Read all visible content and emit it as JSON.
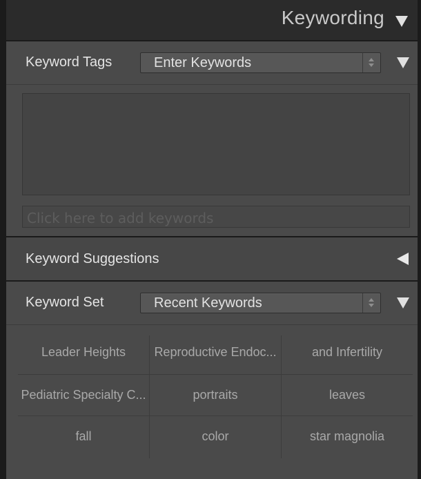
{
  "header": {
    "title": "Keywording"
  },
  "keyword_tags": {
    "label": "Keyword Tags",
    "mode_value": "Enter Keywords",
    "placeholder": "Click here to add keywords"
  },
  "keyword_suggestions": {
    "label": "Keyword Suggestions"
  },
  "keyword_set": {
    "label": "Keyword Set",
    "set_value": "Recent Keywords",
    "keywords": [
      "Leader Heights",
      "Reproductive Endoc...",
      "and Infertility",
      "Pediatric Specialty C...",
      "portraits",
      "leaves",
      "fall",
      "color",
      "star magnolia"
    ]
  },
  "colors": {
    "panel_bg": "#4a4a4a",
    "header_bg": "#2b2b2b",
    "text": "#e4e4e4",
    "keyword_text": "#a9a9a9"
  }
}
